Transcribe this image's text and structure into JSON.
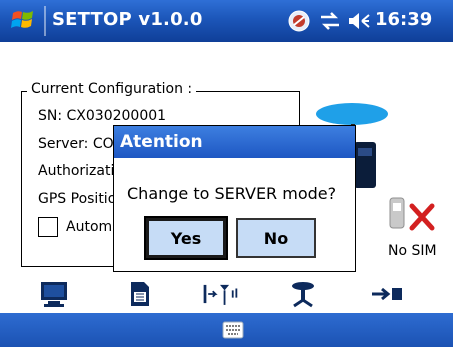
{
  "titlebar": {
    "title": "SETTOP v1.0.0",
    "clock": "16:39",
    "icons": [
      "windows-start-icon",
      "connectivity-icon",
      "data-sync-icon",
      "volume-icon"
    ]
  },
  "config": {
    "legend": "Current Configuration :",
    "sn": "SN: CX030200001",
    "server": "Server: CO",
    "authorization": "Authorizatio",
    "gps_position": "GPS Positio",
    "automatic_label": "Automa",
    "automatic_checked": false
  },
  "status": {
    "sim_label": "No SIM"
  },
  "dialog": {
    "title": "Atention",
    "message": "Change to SERVER mode?",
    "yes_label": "Yes",
    "no_label": "No"
  },
  "toolbar": {
    "icons": [
      "monitor-icon",
      "sim-card-icon",
      "rover-antenna-icon",
      "base-station-icon",
      "arrow-transfer-icon"
    ]
  },
  "colors": {
    "title_bar": "#1c56b9",
    "dialog_title": "#2a6ad6",
    "button_fill": "#c6dcf6",
    "sim_cross": "#d32020"
  }
}
